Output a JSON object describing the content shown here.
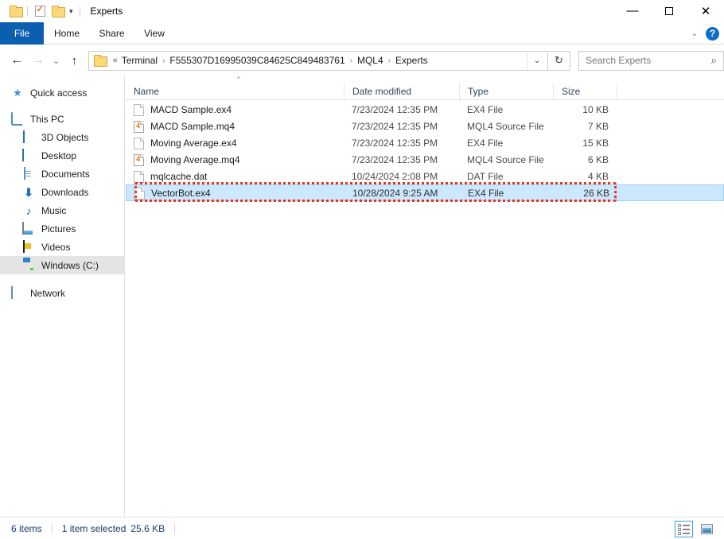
{
  "window": {
    "title": "Experts",
    "quick_access": [
      "folder-icon",
      "properties-icon",
      "new-folder-icon",
      "customize-caret-icon"
    ],
    "controls": {
      "minimize": "—",
      "maximize": "□",
      "close": "✕"
    }
  },
  "ribbon": {
    "tabs": [
      {
        "label": "File",
        "active": true
      },
      {
        "label": "Home",
        "active": false
      },
      {
        "label": "Share",
        "active": false
      },
      {
        "label": "View",
        "active": false
      }
    ],
    "expand_caret": "⌄",
    "help_label": "?"
  },
  "addressbar": {
    "back_icon": "←",
    "forward_icon": "→",
    "history_icon": "⌄",
    "up_icon": "↑",
    "overflow": "«",
    "crumbs": [
      "Terminal",
      "F555307D16995039C84625C849483761",
      "MQL4",
      "Experts"
    ],
    "separator": "›",
    "dropdown_caret": "⌄",
    "refresh_icon": "↻"
  },
  "search": {
    "placeholder": "Search Experts",
    "icon": "⌕"
  },
  "sidebar": {
    "items": [
      {
        "label": "Quick access",
        "icon": "pin-star-icon",
        "indent": false,
        "selected": false
      },
      {
        "label": "This PC",
        "icon": "this-pc-icon",
        "indent": false,
        "selected": false
      },
      {
        "label": "3D Objects",
        "icon": "3d-objects-icon",
        "indent": true,
        "selected": false
      },
      {
        "label": "Desktop",
        "icon": "desktop-icon",
        "indent": true,
        "selected": false
      },
      {
        "label": "Documents",
        "icon": "documents-icon",
        "indent": true,
        "selected": false
      },
      {
        "label": "Downloads",
        "icon": "downloads-icon",
        "indent": true,
        "selected": false
      },
      {
        "label": "Music",
        "icon": "music-icon",
        "indent": true,
        "selected": false
      },
      {
        "label": "Pictures",
        "icon": "pictures-icon",
        "indent": true,
        "selected": false
      },
      {
        "label": "Videos",
        "icon": "videos-icon",
        "indent": true,
        "selected": false
      },
      {
        "label": "Windows (C:)",
        "icon": "drive-icon",
        "indent": true,
        "selected": true
      },
      {
        "label": "Network",
        "icon": "network-icon",
        "indent": false,
        "selected": false
      }
    ]
  },
  "filelist": {
    "columns": [
      "Name",
      "Date modified",
      "Type",
      "Size"
    ],
    "sort_indicator": "^",
    "rows": [
      {
        "name": "MACD Sample.ex4",
        "date": "7/23/2024 12:35 PM",
        "type": "EX4 File",
        "size": "10 KB",
        "icon": "generic-file-icon",
        "selected": false
      },
      {
        "name": "MACD Sample.mq4",
        "date": "7/23/2024 12:35 PM",
        "type": "MQL4 Source File",
        "size": "7 KB",
        "icon": "mq4-file-icon",
        "selected": false
      },
      {
        "name": "Moving Average.ex4",
        "date": "7/23/2024 12:35 PM",
        "type": "EX4 File",
        "size": "15 KB",
        "icon": "generic-file-icon",
        "selected": false
      },
      {
        "name": "Moving Average.mq4",
        "date": "7/23/2024 12:35 PM",
        "type": "MQL4 Source File",
        "size": "6 KB",
        "icon": "mq4-file-icon",
        "selected": false
      },
      {
        "name": "mqlcache.dat",
        "date": "10/24/2024 2:08 PM",
        "type": "DAT File",
        "size": "4 KB",
        "icon": "generic-file-icon",
        "selected": false
      },
      {
        "name": "VectorBot.ex4",
        "date": "10/28/2024 9:25 AM",
        "type": "EX4 File",
        "size": "26 KB",
        "icon": "generic-file-icon",
        "selected": true
      }
    ]
  },
  "annotation": {
    "color": "#f03018",
    "target_row": "VectorBot.ex4"
  },
  "statusbar": {
    "item_count": "6 items",
    "selection": "1 item selected",
    "selection_size": "25.6 KB",
    "views": [
      {
        "name": "details-view",
        "active": true
      },
      {
        "name": "large-icons-view",
        "active": false
      }
    ]
  },
  "colors": {
    "accent": "#0c5eb0",
    "selection": "#cce8ff",
    "annotation": "#f03018"
  }
}
